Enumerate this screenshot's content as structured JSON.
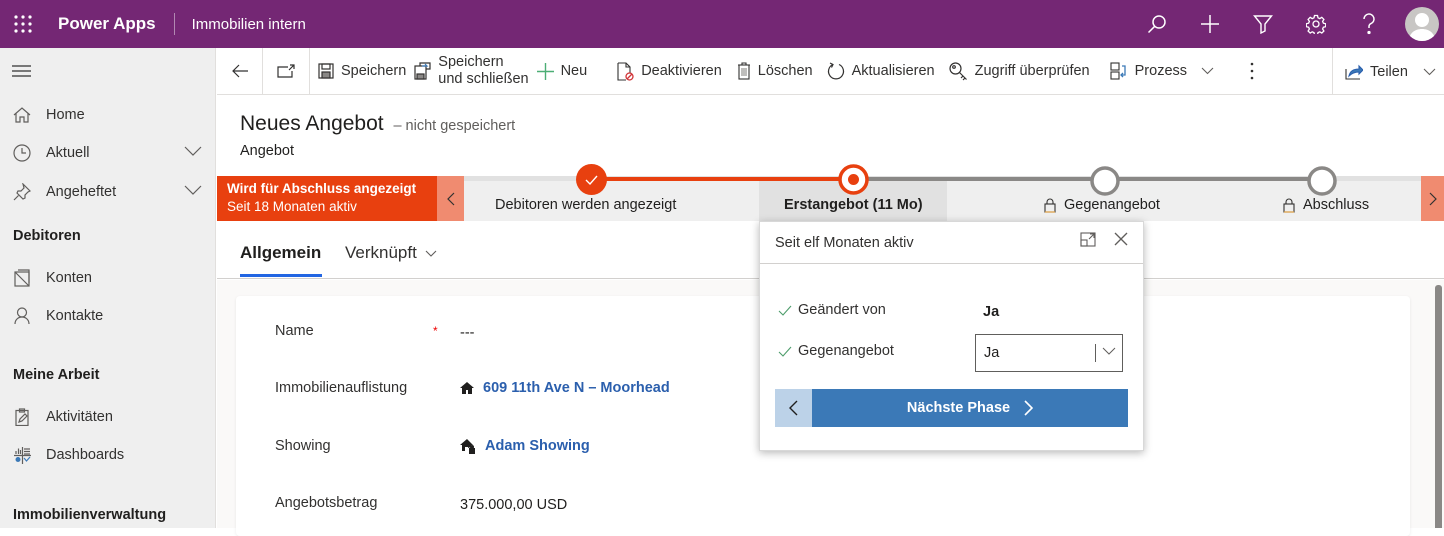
{
  "topbar": {
    "app_name": "Power Apps",
    "environment": "Immobilien intern",
    "icons": [
      "search-icon",
      "plus-icon",
      "filter-icon",
      "gear-icon",
      "help-icon",
      "avatar"
    ]
  },
  "sidebar": {
    "items": [
      {
        "label": "Home",
        "icon": "home-icon"
      },
      {
        "label": "Aktuell",
        "icon": "clock-icon",
        "expandable": true
      },
      {
        "label": "Angeheftet",
        "icon": "pin-icon",
        "expandable": true
      }
    ],
    "groups": [
      {
        "title": "Debitoren",
        "items": [
          {
            "label": "Konten",
            "icon": "accounts-icon"
          },
          {
            "label": "Kontakte",
            "icon": "person-icon"
          }
        ]
      },
      {
        "title": "Meine Arbeit",
        "items": [
          {
            "label": "Aktivitäten",
            "icon": "clipboard-icon"
          },
          {
            "label": "Dashboards",
            "icon": "dashboard-icon"
          }
        ]
      },
      {
        "title": "Immobilienverwaltung",
        "items": []
      }
    ]
  },
  "commandbar": {
    "save": "Speichern",
    "save_close_line1": "Speichern",
    "save_close_line2": "und schließen",
    "new": "Neu",
    "deactivate": "Deaktivieren",
    "delete": "Löschen",
    "refresh": "Aktualisieren",
    "check_access": "Zugriff überprüfen",
    "process": "Prozess",
    "share": "Teilen"
  },
  "record": {
    "title": "Neues Angebot",
    "unsaved": "– nicht gespeichert",
    "entity": "Angebot"
  },
  "bpf": {
    "active_process_title": "Wird für Abschluss angezeigt",
    "active_process_subtitle": "Seit 18 Monaten aktiv",
    "stages": [
      {
        "label": "Debitoren werden angezeigt",
        "status": "completed"
      },
      {
        "label": "Erstangebot (11 Mo)",
        "status": "active"
      },
      {
        "label": "Gegenangebot",
        "status": "locked"
      },
      {
        "label": "Abschluss",
        "status": "locked"
      }
    ],
    "accent_color": "#e8400f"
  },
  "flyout": {
    "header": "Seit elf Monaten aktiv",
    "fields": [
      {
        "label": "Geändert von",
        "value": "Ja"
      },
      {
        "label": "Gegenangebot",
        "value": "Ja",
        "type": "select"
      }
    ],
    "next_stage": "Nächste Phase"
  },
  "tabs": {
    "general": "Allgemein",
    "related": "Verknüpft"
  },
  "form": {
    "fields": [
      {
        "label": "Name",
        "value": "---",
        "required": true
      },
      {
        "label": "Immobilienauflistung",
        "value": "609 11th Ave N – Moorhead",
        "link": true
      },
      {
        "label": "Showing",
        "value": "Adam Showing",
        "link": true
      },
      {
        "label": "Angebotsbetrag",
        "value": "375.000,00 USD"
      }
    ]
  }
}
